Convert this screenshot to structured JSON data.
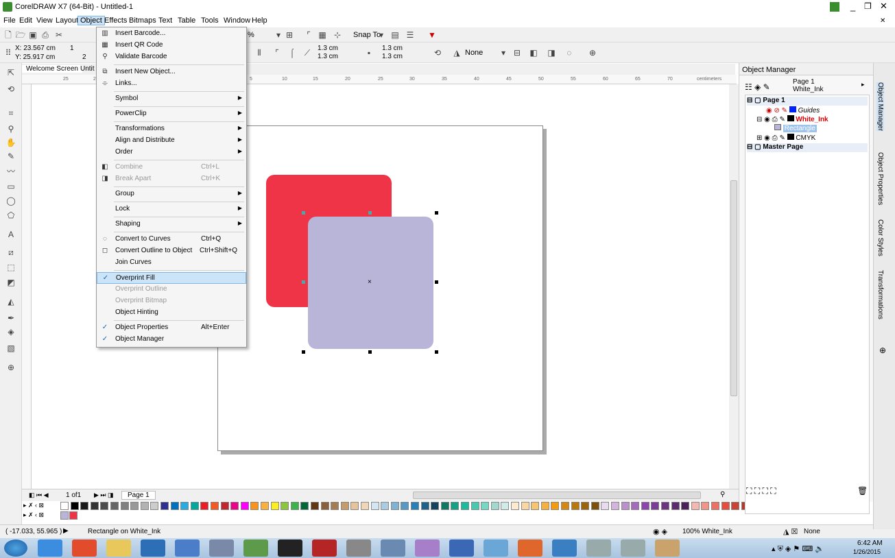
{
  "window": {
    "title": "CorelDRAW X7 (64-Bit) - Untitled-1"
  },
  "menubar": [
    "File",
    "Edit",
    "View",
    "Layout",
    "Object",
    "Effects",
    "Bitmaps",
    "Text",
    "Table",
    "Tools",
    "Window",
    "Help"
  ],
  "toolbar": {
    "zoom_suffix": "%",
    "snap_to": "Snap To",
    "x_value": "X: 23.567 cm",
    "y_value": "Y: 25.917 cm",
    "w_partial": "1",
    "h_partial": "2",
    "corner1": "1.3 cm",
    "corner2": "1.3 cm",
    "corner3": "1.3 cm",
    "corner4": "1.3 cm",
    "outline": "None"
  },
  "doc_tabs": {
    "welcome": "Welcome Screen",
    "untitled": "Untit"
  },
  "ruler": {
    "unit": "centimeters",
    "ticks": [
      "25",
      "20",
      "5",
      "10",
      "15",
      "20",
      "25",
      "30",
      "35",
      "40",
      "45",
      "50",
      "55",
      "60",
      "65",
      "70"
    ]
  },
  "object_menu": {
    "items": [
      {
        "label": "Insert Barcode...",
        "shortcut": "",
        "icon": "barcode-icon",
        "submenu": false,
        "disabled": false
      },
      {
        "label": "Insert QR Code",
        "shortcut": "",
        "icon": "qr-code-icon",
        "submenu": false,
        "disabled": false
      },
      {
        "label": "Validate Barcode",
        "shortcut": "",
        "icon": "validate-icon",
        "submenu": false,
        "disabled": false
      },
      {
        "sep": true
      },
      {
        "label": "Insert New Object...",
        "shortcut": "",
        "icon": "insert-object-icon",
        "submenu": false,
        "disabled": false
      },
      {
        "label": "Links...",
        "shortcut": "",
        "icon": "links-icon",
        "submenu": false,
        "disabled": false
      },
      {
        "sep": true
      },
      {
        "label": "Symbol",
        "shortcut": "",
        "icon": "",
        "submenu": true,
        "disabled": false
      },
      {
        "sep": true
      },
      {
        "label": "PowerClip",
        "shortcut": "",
        "icon": "",
        "submenu": true,
        "disabled": false
      },
      {
        "sep": true
      },
      {
        "label": "Transformations",
        "shortcut": "",
        "icon": "",
        "submenu": true,
        "disabled": false
      },
      {
        "label": "Align and Distribute",
        "shortcut": "",
        "icon": "",
        "submenu": true,
        "disabled": false
      },
      {
        "label": "Order",
        "shortcut": "",
        "icon": "",
        "submenu": true,
        "disabled": false
      },
      {
        "sep": true
      },
      {
        "label": "Combine",
        "shortcut": "Ctrl+L",
        "icon": "combine-icon",
        "submenu": false,
        "disabled": true
      },
      {
        "label": "Break Apart",
        "shortcut": "Ctrl+K",
        "icon": "break-apart-icon",
        "submenu": false,
        "disabled": true
      },
      {
        "sep": true
      },
      {
        "label": "Group",
        "shortcut": "",
        "icon": "",
        "submenu": true,
        "disabled": false
      },
      {
        "sep": true
      },
      {
        "label": "Lock",
        "shortcut": "",
        "icon": "",
        "submenu": true,
        "disabled": false
      },
      {
        "sep": true
      },
      {
        "label": "Shaping",
        "shortcut": "",
        "icon": "",
        "submenu": true,
        "disabled": false
      },
      {
        "sep": true
      },
      {
        "label": "Convert to Curves",
        "shortcut": "Ctrl+Q",
        "icon": "convert-curves-icon",
        "submenu": false,
        "disabled": false
      },
      {
        "label": "Convert Outline to Object",
        "shortcut": "Ctrl+Shift+Q",
        "icon": "outline-object-icon",
        "submenu": false,
        "disabled": false
      },
      {
        "label": "Join Curves",
        "shortcut": "",
        "icon": "",
        "submenu": false,
        "disabled": false
      },
      {
        "sep": true
      },
      {
        "label": "Overprint Fill",
        "shortcut": "",
        "icon": "check-icon",
        "submenu": false,
        "disabled": false,
        "highlighted": true
      },
      {
        "label": "Overprint Outline",
        "shortcut": "",
        "icon": "",
        "submenu": false,
        "disabled": true
      },
      {
        "label": "Overprint Bitmap",
        "shortcut": "",
        "icon": "",
        "submenu": false,
        "disabled": true
      },
      {
        "label": "Object Hinting",
        "shortcut": "",
        "icon": "",
        "submenu": false,
        "disabled": false
      },
      {
        "sep": true
      },
      {
        "label": "Object Properties",
        "shortcut": "Alt+Enter",
        "icon": "check-icon",
        "submenu": false,
        "disabled": false
      },
      {
        "label": "Object Manager",
        "shortcut": "",
        "icon": "check-icon",
        "submenu": false,
        "disabled": false
      }
    ]
  },
  "page_nav": {
    "counter": "1 of1",
    "page_tab": "Page 1"
  },
  "status": {
    "coords": "( -17.033, 55.965 )",
    "message": "Rectangle on White_Ink",
    "fill_info": "100% White_Ink",
    "outline_info": "None"
  },
  "object_manager": {
    "title": "Object Manager",
    "current_page": "Page 1",
    "current_layer": "White_Ink",
    "tree": [
      {
        "label": "Page 1",
        "level": 0,
        "bold": true
      },
      {
        "label": "Guides",
        "level": 2,
        "italic": true
      },
      {
        "label": "White_Ink",
        "level": 1,
        "red": true
      },
      {
        "label": "Rectangle",
        "level": 2,
        "selected": true
      },
      {
        "label": "CMYK",
        "level": 1
      },
      {
        "label": "Master Page",
        "level": 0,
        "bold": true
      }
    ]
  },
  "side_tabs": [
    "Object Manager",
    "Object Properties",
    "Color Styles",
    "Transformations"
  ],
  "taskbar": {
    "time": "6:42 AM",
    "date": "1/26/2015"
  },
  "colors": {
    "red_rect": "#ef3447",
    "lavender_rect": "#b8b5d9",
    "palette": [
      "#ffffff",
      "#000000",
      "#1a1a1a",
      "#333333",
      "#4d4d4d",
      "#666666",
      "#808080",
      "#999999",
      "#b3b3b3",
      "#cccccc",
      "#2e3192",
      "#0071bc",
      "#29abe2",
      "#00a99d",
      "#ed1c24",
      "#f15a24",
      "#c1272d",
      "#ec008c",
      "#ff00ff",
      "#f7941d",
      "#fbb03b",
      "#fcee21",
      "#8cc63f",
      "#39b54a",
      "#006837",
      "#603813",
      "#8b5e3c",
      "#a67c52",
      "#c69c6d",
      "#e6c39a",
      "#f2d4b6",
      "#d4e6f1",
      "#a9cce3",
      "#7fb3d5",
      "#5499c7",
      "#2980b9",
      "#1f618d",
      "#154360",
      "#117864",
      "#16a085",
      "#1abc9c",
      "#48c9b0",
      "#76d7c4",
      "#a2d9ce",
      "#d0ece7",
      "#fdebd0",
      "#fad7a0",
      "#f8c471",
      "#f5b041",
      "#f39c12",
      "#d68910",
      "#b9770e",
      "#9c640c",
      "#7e5109",
      "#e8daef",
      "#d2b4de",
      "#bb8fce",
      "#a569bd",
      "#8e44ad",
      "#7d3c98",
      "#6c3483",
      "#5b2c6f",
      "#4a235a",
      "#f5b7b1",
      "#f1948a",
      "#ec7063",
      "#e74c3c",
      "#cb4335",
      "#b03a2e",
      "#943126",
      "#78281f",
      "#fadbd8",
      "#ebdef0",
      "#d6eaf8",
      "#d1f2eb",
      "#fcf3cf",
      "#fae5d3",
      "#f6ddcc"
    ],
    "doc_palette": [
      "#b8b5d9",
      "#ef3447"
    ]
  }
}
